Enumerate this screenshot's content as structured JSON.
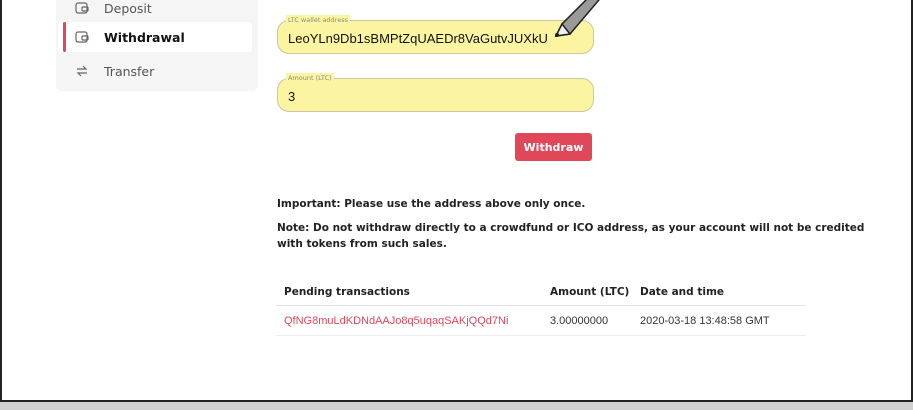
{
  "sidebar": {
    "items": [
      {
        "label": "Deposit",
        "icon": "wallet-icon"
      },
      {
        "label": "Withdrawal",
        "icon": "wallet-icon"
      },
      {
        "label": "Transfer",
        "icon": "transfer-arrows-icon"
      }
    ],
    "active": "Withdrawal"
  },
  "form": {
    "address_label": "LTC wallet address",
    "address_value": "LeoYLn9Db1sBMPtZqUAEDr8VaGutvJUXkU",
    "amount_label": "Amount (LTC)",
    "amount_value": "3",
    "submit_label": "Withdraw"
  },
  "notes": {
    "important": "Important: Please use the address above only once.",
    "note_line1": "Note: Do not withdraw directly to a crowdfund or ICO address, as your account will not be credited",
    "note_line2": "with tokens from such sales."
  },
  "table": {
    "headers": [
      "Pending transactions",
      "Amount (LTC)",
      "Date and time"
    ],
    "rows": [
      [
        "QfNG8muLdKDNdAAJo8q5uqaqSAKjQQd7Ni",
        "3.00000000",
        "2020-03-18 13:48:58 GMT"
      ]
    ]
  },
  "colors": {
    "accent": "#e0485a",
    "highlight": "#fbf4a0"
  }
}
